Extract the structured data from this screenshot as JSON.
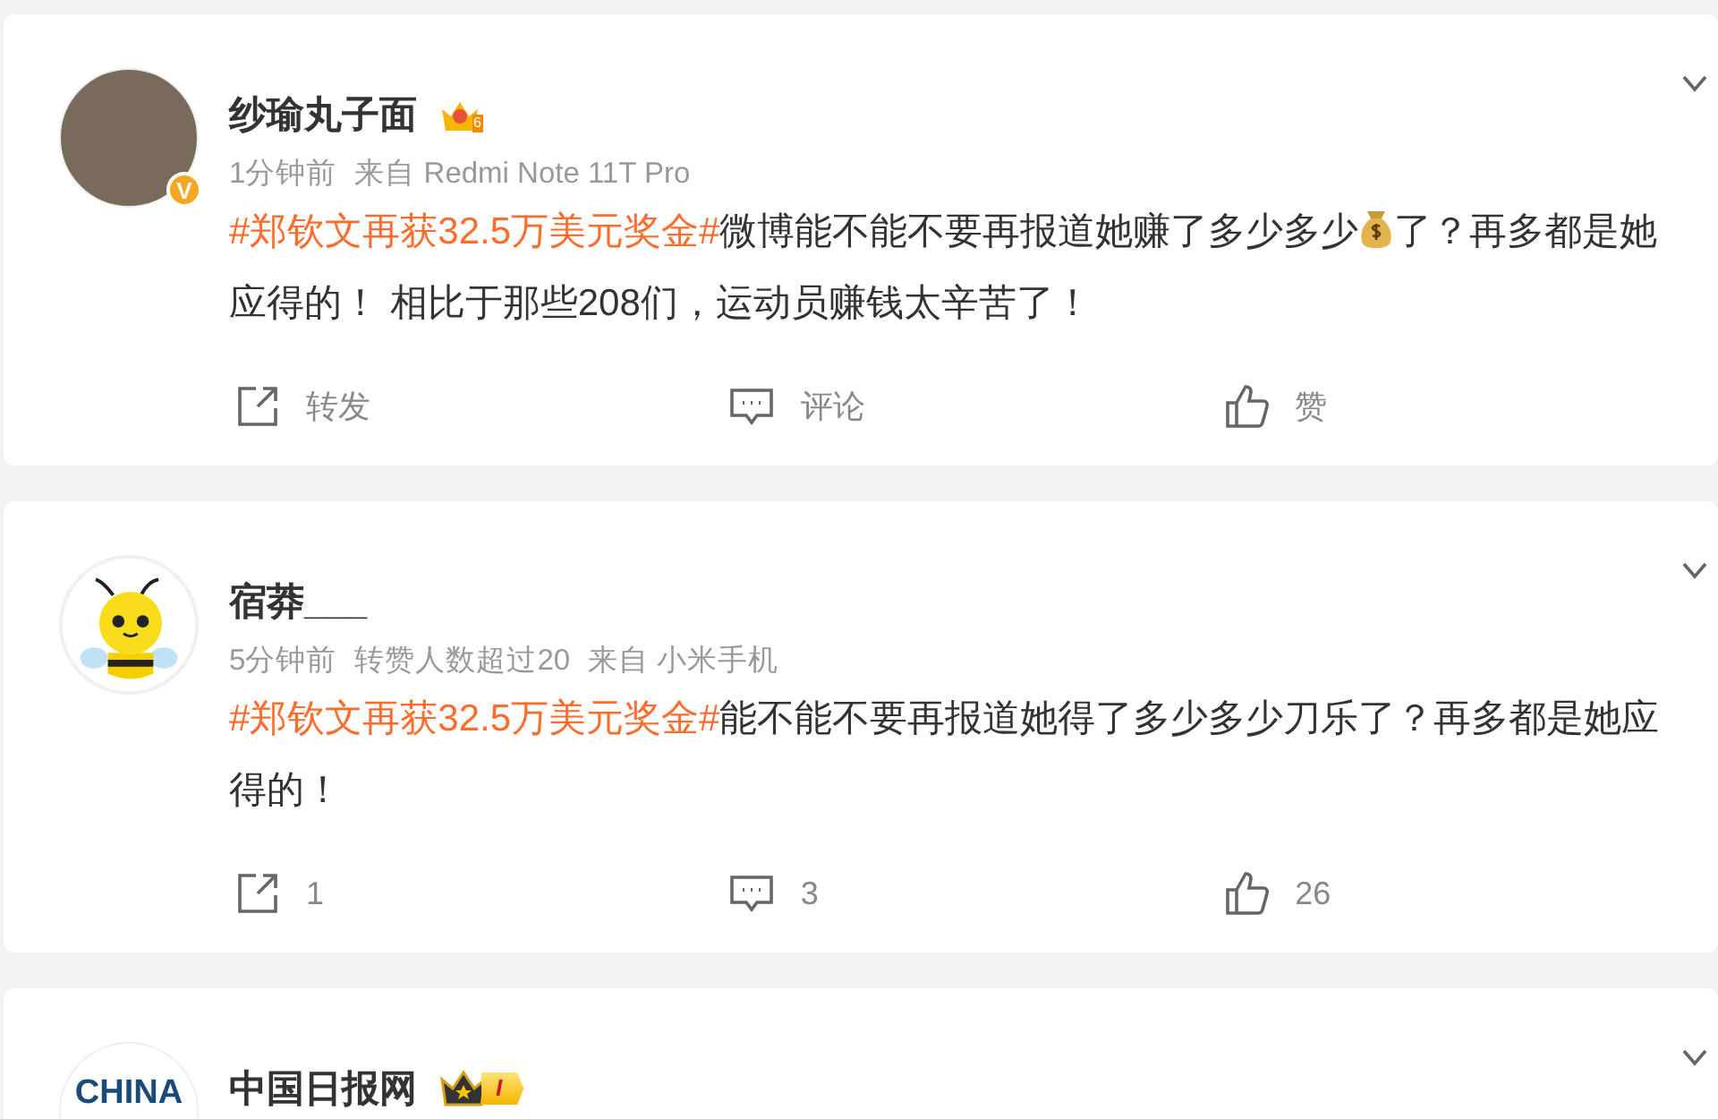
{
  "posts": [
    {
      "author": "纱瑜丸子面",
      "avatar": {
        "kind": "photo",
        "badge": "V"
      },
      "name_badge": {
        "kind": "crown-gold",
        "level": "6"
      },
      "meta": [
        "1分钟前",
        "来自 Redmi Note 11T Pro"
      ],
      "body": [
        {
          "kind": "hashtag",
          "text": "#郑钦文再获32.5万美元奖金#"
        },
        {
          "kind": "text",
          "text": "微博能不能不要再报道她赚了多少多少"
        },
        {
          "kind": "emoji"
        },
        {
          "kind": "text",
          "text": "了？再多都是她应得的！ 相比于那些208们，运动员赚钱太辛苦了！"
        }
      ],
      "actions": [
        {
          "kind": "repost",
          "label": "转发"
        },
        {
          "kind": "comment",
          "label": "评论"
        },
        {
          "kind": "like",
          "label": "赞"
        }
      ]
    },
    {
      "author": "宿莽___",
      "avatar": {
        "kind": "bee"
      },
      "meta": [
        "5分钟前",
        "转赞人数超过20",
        "来自 小米手机"
      ],
      "body": [
        {
          "kind": "hashtag",
          "text": "#郑钦文再获32.5万美元奖金#"
        },
        {
          "kind": "text",
          "text": "能不能不要再报道她得了多少多少刀乐了？再多都是她应得的！"
        }
      ],
      "actions": [
        {
          "kind": "repost",
          "label": "1"
        },
        {
          "kind": "comment",
          "label": "3"
        },
        {
          "kind": "like",
          "label": "26"
        }
      ]
    },
    {
      "author": "中国日报网",
      "avatar": {
        "kind": "logo",
        "text": "CHINA"
      },
      "name_badge": {
        "kind": "crown-dark",
        "level": "I"
      }
    }
  ]
}
